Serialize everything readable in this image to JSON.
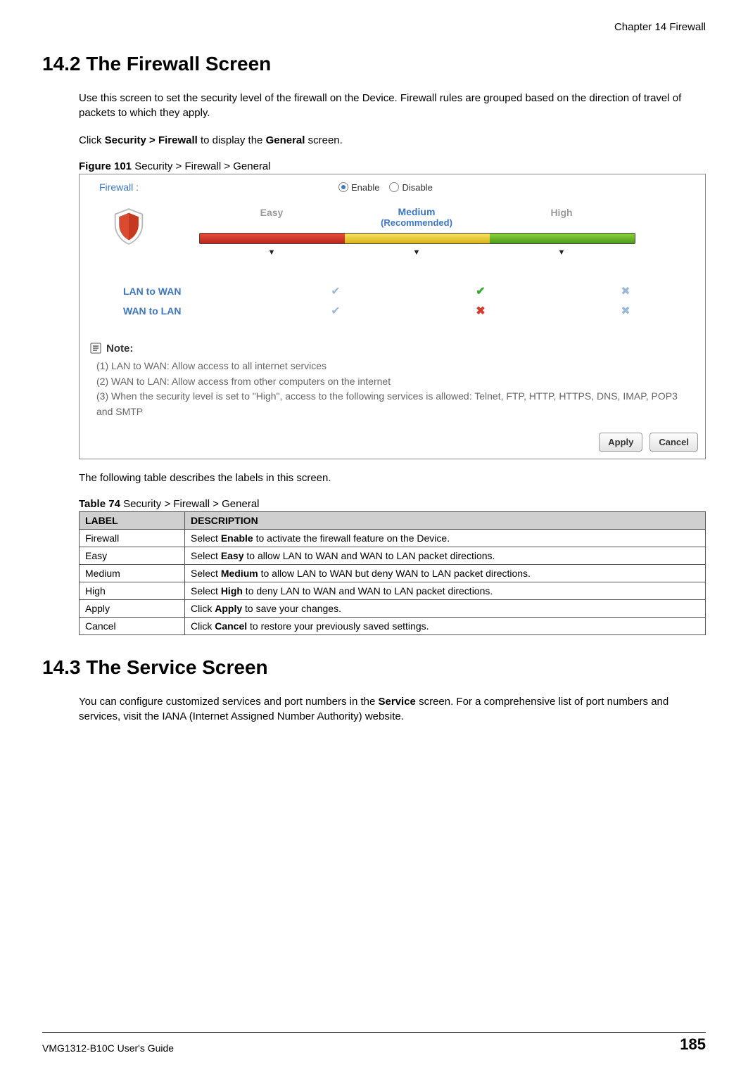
{
  "header": {
    "chapter": "Chapter 14 Firewall"
  },
  "section1": {
    "title": "14.2  The Firewall Screen",
    "para1": "Use this screen to set the security level of the firewall on the Device. Firewall rules are grouped based on the direction of travel of packets to which they apply.",
    "para2_pre": "Click ",
    "para2_b1": "Security > Firewall",
    "para2_mid": " to display the ",
    "para2_b2": "General",
    "para2_post": " screen.",
    "figure_label": "Figure 101",
    "figure_title": "   Security > Firewall > General",
    "after_figure": "The following table describes the labels in this screen.",
    "table_label": "Table 74",
    "table_title": "   Security > Firewall > General"
  },
  "figure": {
    "firewall_label": "Firewall :",
    "enable": "Enable",
    "disable": "Disable",
    "levels": {
      "easy": "Easy",
      "medium": "Medium",
      "medium_sub": "(Recommended)",
      "high": "High"
    },
    "rows": {
      "lan_to_wan": "LAN to WAN",
      "wan_to_lan": "WAN to LAN"
    },
    "note_title": "Note:",
    "note1": "(1) LAN to WAN: Allow access to all internet services",
    "note2": "(2) WAN to LAN: Allow access from other computers on the internet",
    "note3": "(3) When the security level is set to \"High\", access to the following services is allowed: Telnet, FTP, HTTP, HTTPS, DNS, IMAP, POP3 and SMTP",
    "btn_apply": "Apply",
    "btn_cancel": "Cancel"
  },
  "table": {
    "head_label": "LABEL",
    "head_desc": "DESCRIPTION",
    "rows": [
      {
        "label": "Firewall",
        "pre": "Select ",
        "b": "Enable",
        "post": " to activate the firewall feature on the Device."
      },
      {
        "label": "Easy",
        "pre": "Select ",
        "b": "Easy",
        "post": " to allow LAN to WAN and WAN to LAN packet directions."
      },
      {
        "label": "Medium",
        "pre": "Select ",
        "b": "Medium",
        "post": " to allow LAN to WAN but deny WAN to LAN packet directions."
      },
      {
        "label": "High",
        "pre": "Select ",
        "b": "High",
        "post": " to deny LAN to WAN and WAN to LAN packet directions."
      },
      {
        "label": "Apply",
        "pre": "Click ",
        "b": "Apply",
        "post": " to save your changes."
      },
      {
        "label": "Cancel",
        "pre": "Click ",
        "b": "Cancel",
        "post": " to restore your previously saved settings."
      }
    ]
  },
  "section2": {
    "title": "14.3  The Service Screen",
    "para1_pre": "You can configure customized services and port numbers in the ",
    "para1_b": "Service",
    "para1_post": " screen. For a comprehensive list of port numbers and services, visit the IANA (Internet Assigned Number Authority) website."
  },
  "footer": {
    "guide": "VMG1312-B10C User's Guide",
    "page": "185"
  }
}
